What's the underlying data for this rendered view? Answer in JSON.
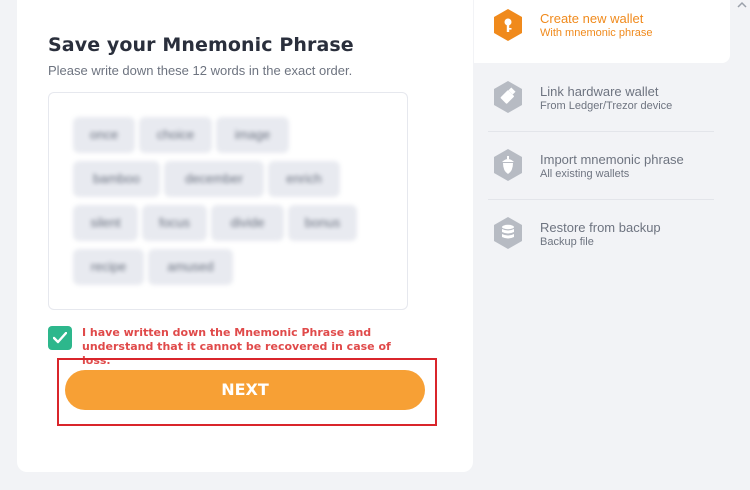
{
  "form": {
    "title": "Save your Mnemonic Phrase",
    "subtitle": "Please write down these 12 words in the exact order.",
    "words": [
      "once",
      "choice",
      "image",
      "bamboo",
      "december",
      "enrich",
      "silent",
      "focus",
      "divide",
      "bonus",
      "recipe",
      "amused"
    ],
    "confirm_checked": true,
    "confirm_text": "I have written down the Mnemonic Phrase and understand that it cannot be recovered in case of loss.",
    "next_label": "NEXT"
  },
  "sidebar": {
    "items": [
      {
        "title": "Create new wallet",
        "subtitle": "With mnemonic phrase",
        "icon": "key-icon",
        "active": true
      },
      {
        "title": "Link hardware wallet",
        "subtitle": "From Ledger/Trezor device",
        "icon": "usb-icon",
        "active": false
      },
      {
        "title": "Import mnemonic phrase",
        "subtitle": "All existing wallets",
        "icon": "acorn-icon",
        "active": false
      },
      {
        "title": "Restore from backup",
        "subtitle": "Backup file",
        "icon": "database-icon",
        "active": false
      }
    ]
  },
  "colors": {
    "accent": "#f7a035",
    "active_text": "#f08a1c",
    "check_green": "#2db78c",
    "warning_red": "#e04a4a",
    "highlight_frame": "#d9252b"
  }
}
